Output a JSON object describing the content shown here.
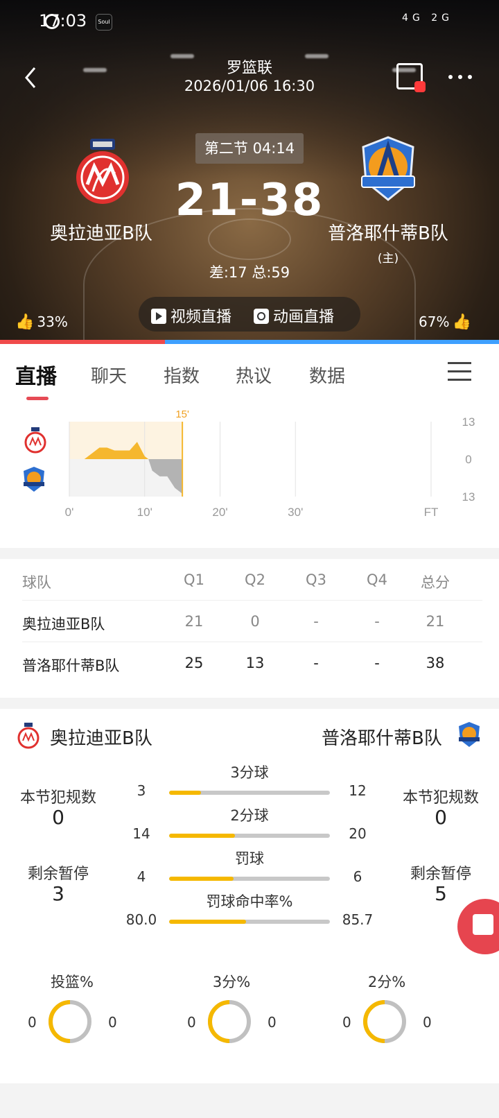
{
  "status": {
    "time": "17:03",
    "app_badge": "Soul",
    "signal": "4G 2G"
  },
  "header": {
    "league": "罗篮联",
    "datetime": "2026/01/06 16:30"
  },
  "match": {
    "period": "第二节 04:14",
    "score": "21-38",
    "diff_total": "差:17 总:59",
    "home": {
      "name": "奥拉迪亚B队",
      "color": "#e0312f"
    },
    "away": {
      "name": "普洛耶什蒂B队",
      "tag": "(主)",
      "color": "#2d6fd0"
    }
  },
  "live": {
    "video": "视频直播",
    "animation": "动画直播"
  },
  "votes": {
    "home_pct": "33%",
    "away_pct": "67%",
    "home_fraction": 0.33
  },
  "tabs": [
    {
      "label": "直播",
      "active": true
    },
    {
      "label": "聊天"
    },
    {
      "label": "指数"
    },
    {
      "label": "热议"
    },
    {
      "label": "数据"
    }
  ],
  "chart_data": {
    "type": "area",
    "current_marker": "15'",
    "x_ticks": [
      "0'",
      "10'",
      "20'",
      "30'",
      "FT"
    ],
    "y_ticks": [
      "13",
      "0",
      "13"
    ],
    "x": [
      0,
      2,
      3,
      4,
      5,
      6,
      7,
      8,
      9,
      10,
      10.5,
      11,
      12,
      13,
      14,
      15
    ],
    "diff": [
      0,
      0,
      2,
      4,
      4,
      3,
      3,
      3,
      6,
      1,
      0,
      -4,
      -6,
      -6,
      -10,
      -12
    ],
    "ylim": [
      -13,
      13
    ],
    "xlim": [
      0,
      48
    ]
  },
  "score_table": {
    "headers": [
      "球队",
      "Q1",
      "Q2",
      "Q3",
      "Q4",
      "总分"
    ],
    "rows": [
      [
        "奥拉迪亚B队",
        "21",
        "0",
        "-",
        "-",
        "21"
      ],
      [
        "普洛耶什蒂B队",
        "25",
        "13",
        "-",
        "-",
        "38"
      ]
    ]
  },
  "stats": {
    "home_name": "奥拉迪亚B队",
    "away_name": "普洛耶什蒂B队",
    "fouls_label": "本节犯规数",
    "home_fouls": "0",
    "away_fouls": "0",
    "timeouts_label": "剩余暂停",
    "home_timeouts": "3",
    "away_timeouts": "5",
    "bars": [
      {
        "label": "3分球",
        "home": "3",
        "away": "12",
        "home_share": 0.2
      },
      {
        "label": "2分球",
        "home": "14",
        "away": "20",
        "home_share": 0.41
      },
      {
        "label": "罚球",
        "home": "4",
        "away": "6",
        "home_share": 0.4
      },
      {
        "label": "罚球命中率%",
        "home": "80.0",
        "away": "85.7",
        "home_share": 0.48
      }
    ],
    "rings": [
      {
        "title": "投篮%",
        "home": "0",
        "away": "0"
      },
      {
        "title": "3分%",
        "home": "0",
        "away": "0"
      },
      {
        "title": "2分%",
        "home": "0",
        "away": "0"
      }
    ]
  }
}
